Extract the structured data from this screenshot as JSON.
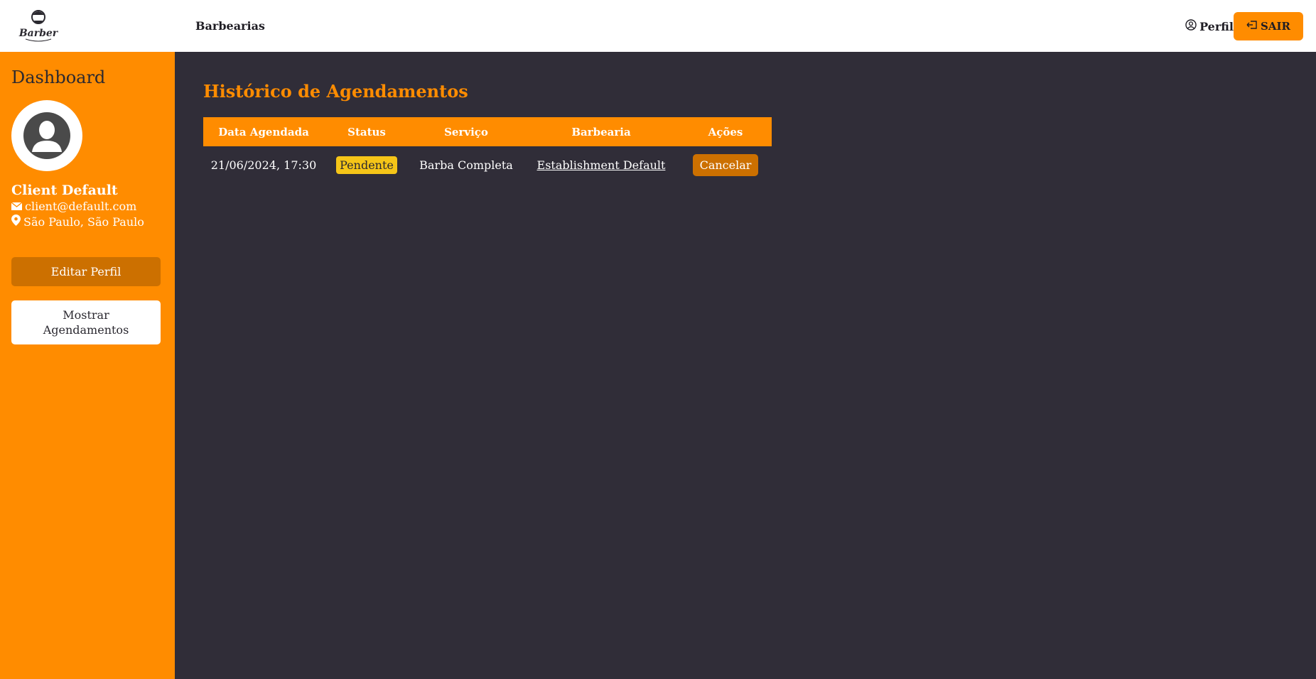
{
  "brand": {
    "logo_text": "Barber"
  },
  "nav": {
    "barbearias_label": "Barbearias",
    "profile_label": "Perfil",
    "logout_label": "SAIR"
  },
  "sidebar": {
    "title": "Dashboard",
    "user_name": "Client Default",
    "user_email": "client@default.com",
    "user_location": "São Paulo, São Paulo",
    "edit_profile_label": "Editar Perfil",
    "show_appointments_label": "Mostrar Agendamentos"
  },
  "main": {
    "title": "Histórico de Agendamentos",
    "table": {
      "headers": [
        "Data Agendada",
        "Status",
        "Serviço",
        "Barbearia",
        "Ações"
      ],
      "rows": [
        {
          "date": "21/06/2024, 17:30",
          "status": "Pendente",
          "service": "Barba Completa",
          "establishment": "Establishment Default",
          "action_label": "Cancelar"
        }
      ]
    }
  },
  "colors": {
    "accent": "#ff8c00",
    "accent_dark": "#cc7000",
    "background": "#302d38",
    "status_pending": "#f5c518"
  }
}
